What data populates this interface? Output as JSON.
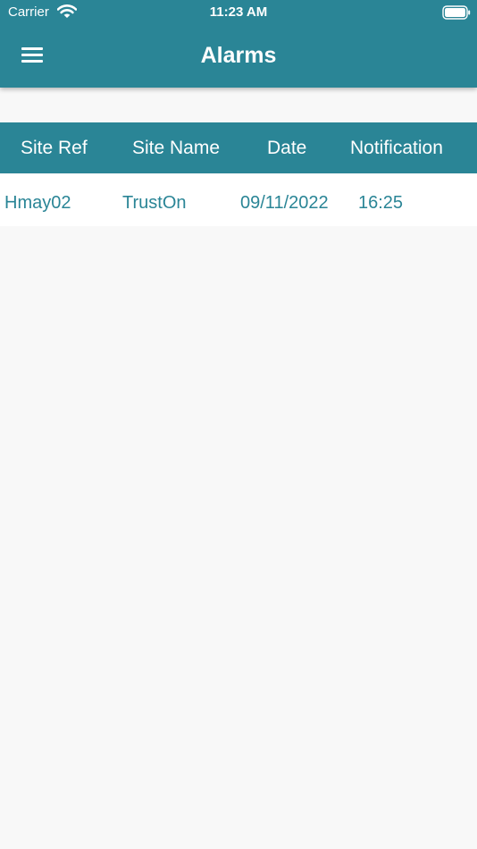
{
  "status_bar": {
    "carrier": "Carrier",
    "time": "11:23 AM"
  },
  "app_bar": {
    "title": "Alarms",
    "menu_icon": "hamburger-menu-icon"
  },
  "table": {
    "columns": [
      "Site Ref",
      "Site Name",
      "Date",
      "Notification"
    ],
    "rows": [
      [
        "Hmay02",
        "TrustOn",
        "09/11/2022",
        "16:25"
      ]
    ]
  },
  "colors": {
    "primary": "#2a8596",
    "background": "#f8f8f8",
    "row_background": "#ffffff",
    "on_primary": "#ffffff"
  }
}
